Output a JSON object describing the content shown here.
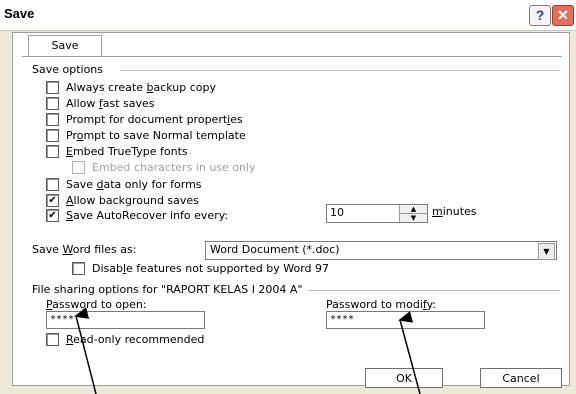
{
  "window": {
    "title": "Save",
    "help_label": "?",
    "close_label": "✕"
  },
  "tab": {
    "label": "Save"
  },
  "save_options": {
    "header": "Save options",
    "items": [
      {
        "pre": "Always create ",
        "u": "b",
        "post": "ackup copy",
        "checked": false,
        "disabled": false
      },
      {
        "pre": "Allow ",
        "u": "f",
        "post": "ast saves",
        "checked": false,
        "disabled": false
      },
      {
        "pre": "Prompt for document propert",
        "u": "i",
        "post": "es",
        "checked": false,
        "disabled": false
      },
      {
        "pre": "Pr",
        "u": "o",
        "post": "mpt to save Normal template",
        "checked": false,
        "disabled": false
      },
      {
        "pre": "",
        "u": "E",
        "post": "mbed TrueType fonts",
        "checked": false,
        "disabled": false
      },
      {
        "pre": "Embed characters in use only",
        "u": "",
        "post": "",
        "checked": false,
        "disabled": true
      },
      {
        "pre": "Save ",
        "u": "d",
        "post": "ata only for forms",
        "checked": false,
        "disabled": false
      },
      {
        "pre": "",
        "u": "A",
        "post": "llow background saves",
        "checked": true,
        "disabled": false
      },
      {
        "pre": "",
        "u": "S",
        "post": "ave AutoRecover info every:",
        "checked": true,
        "disabled": false
      }
    ],
    "autorecover": {
      "value": "10",
      "unit_u": "m",
      "unit_rest": "inutes"
    },
    "save_as": {
      "label_pre": "Save ",
      "label_u": "W",
      "label_post": "ord files as:",
      "selected": "Word Document (*.doc)"
    },
    "disable_features": {
      "pre": "Disab",
      "u": "l",
      "post": "e features not supported by Word 97",
      "checked": false
    }
  },
  "file_sharing": {
    "header": "File sharing options for \"RAPORT KELAS I 2004 A\"",
    "password_open": {
      "pre": "",
      "u": "P",
      "post": "assword to open:",
      "value": "****"
    },
    "password_modify": {
      "pre": "Password to modi",
      "u": "f",
      "post": "y:",
      "value": "****"
    },
    "readonly": {
      "pre": "",
      "u": "R",
      "post": "ead-only recommended",
      "checked": false
    }
  },
  "buttons": {
    "ok": "OK",
    "cancel": "Cancel"
  },
  "colors": {
    "dialog_bg": "#ece9d8",
    "close_red": "#e07060",
    "arrow": "#000000"
  }
}
